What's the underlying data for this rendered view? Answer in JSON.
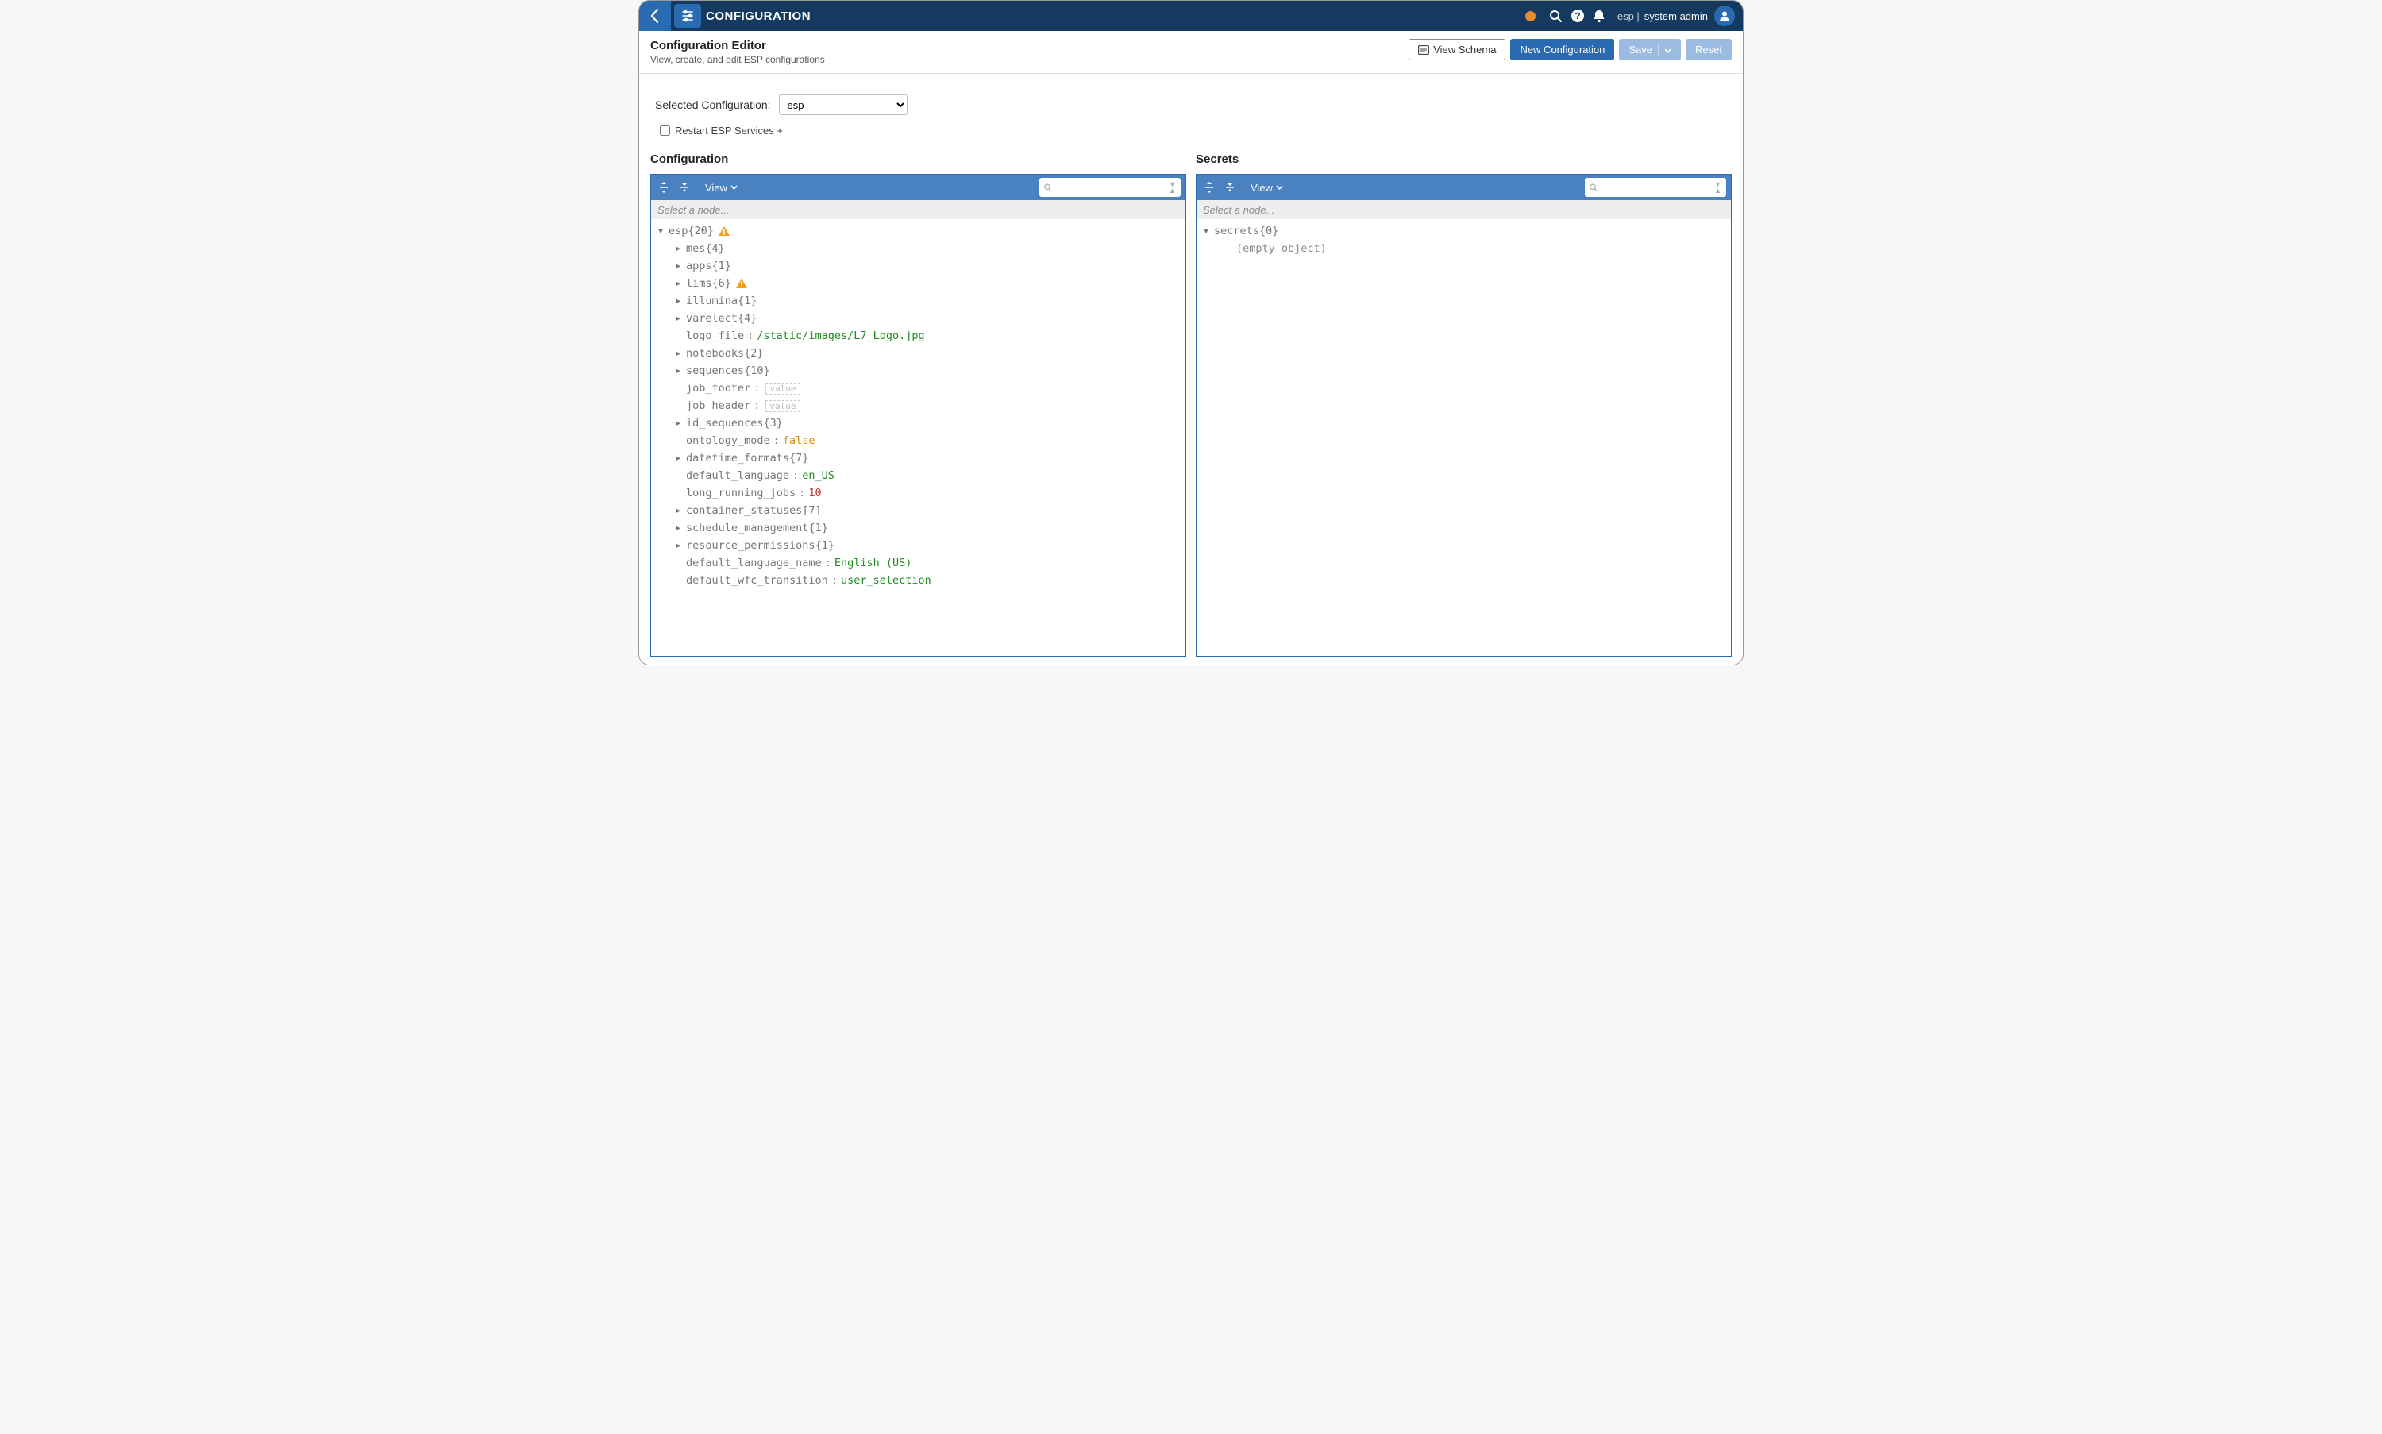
{
  "nav": {
    "title": "CONFIGURATION",
    "user_context": "esp |",
    "user_name": "system admin"
  },
  "header": {
    "title": "Configuration Editor",
    "subtitle": "View, create, and edit ESP configurations",
    "view_schema": "View Schema",
    "new_config": "New Configuration",
    "save": "Save",
    "reset": "Reset"
  },
  "selector": {
    "label": "Selected Configuration:",
    "value": "esp",
    "restart_label": "Restart ESP Services +"
  },
  "panels": {
    "config_heading": "Configuration",
    "secrets_heading": "Secrets",
    "view_label": "View",
    "path_placeholder": "Select a node..."
  },
  "config_tree": {
    "root_key": "esp",
    "root_count": "{20}",
    "items": [
      {
        "type": "node",
        "key": "mes",
        "count": "{4}"
      },
      {
        "type": "node",
        "key": "apps",
        "count": "{1}"
      },
      {
        "type": "node",
        "key": "lims",
        "count": "{6}",
        "warn": true
      },
      {
        "type": "node",
        "key": "illumina",
        "count": "{1}"
      },
      {
        "type": "node",
        "key": "varelect",
        "count": "{4}"
      },
      {
        "type": "leaf",
        "key": "logo_file",
        "value": "/static/images/L7_Logo.jpg",
        "vtype": "str"
      },
      {
        "type": "node",
        "key": "notebooks",
        "count": "{2}"
      },
      {
        "type": "node",
        "key": "sequences",
        "count": "{10}"
      },
      {
        "type": "leaf",
        "key": "job_footer",
        "value": "value",
        "vtype": "empty"
      },
      {
        "type": "leaf",
        "key": "job_header",
        "value": "value",
        "vtype": "empty"
      },
      {
        "type": "node",
        "key": "id_sequences",
        "count": "{3}"
      },
      {
        "type": "leaf",
        "key": "ontology_mode",
        "value": "false",
        "vtype": "bool"
      },
      {
        "type": "node",
        "key": "datetime_formats",
        "count": "{7}"
      },
      {
        "type": "leaf",
        "key": "default_language",
        "value": "en_US",
        "vtype": "str"
      },
      {
        "type": "leaf",
        "key": "long_running_jobs",
        "value": "10",
        "vtype": "num"
      },
      {
        "type": "node",
        "key": "container_statuses",
        "count": "[7]"
      },
      {
        "type": "node",
        "key": "schedule_management",
        "count": "{1}"
      },
      {
        "type": "node",
        "key": "resource_permissions",
        "count": "{1}"
      },
      {
        "type": "leaf",
        "key": "default_language_name",
        "value": "English (US)",
        "vtype": "str"
      },
      {
        "type": "leaf",
        "key": "default_wfc_transition",
        "value": "user_selection",
        "vtype": "str"
      }
    ]
  },
  "secrets_tree": {
    "root_key": "secrets",
    "root_count": "{0}",
    "empty_text": "(empty object)"
  }
}
